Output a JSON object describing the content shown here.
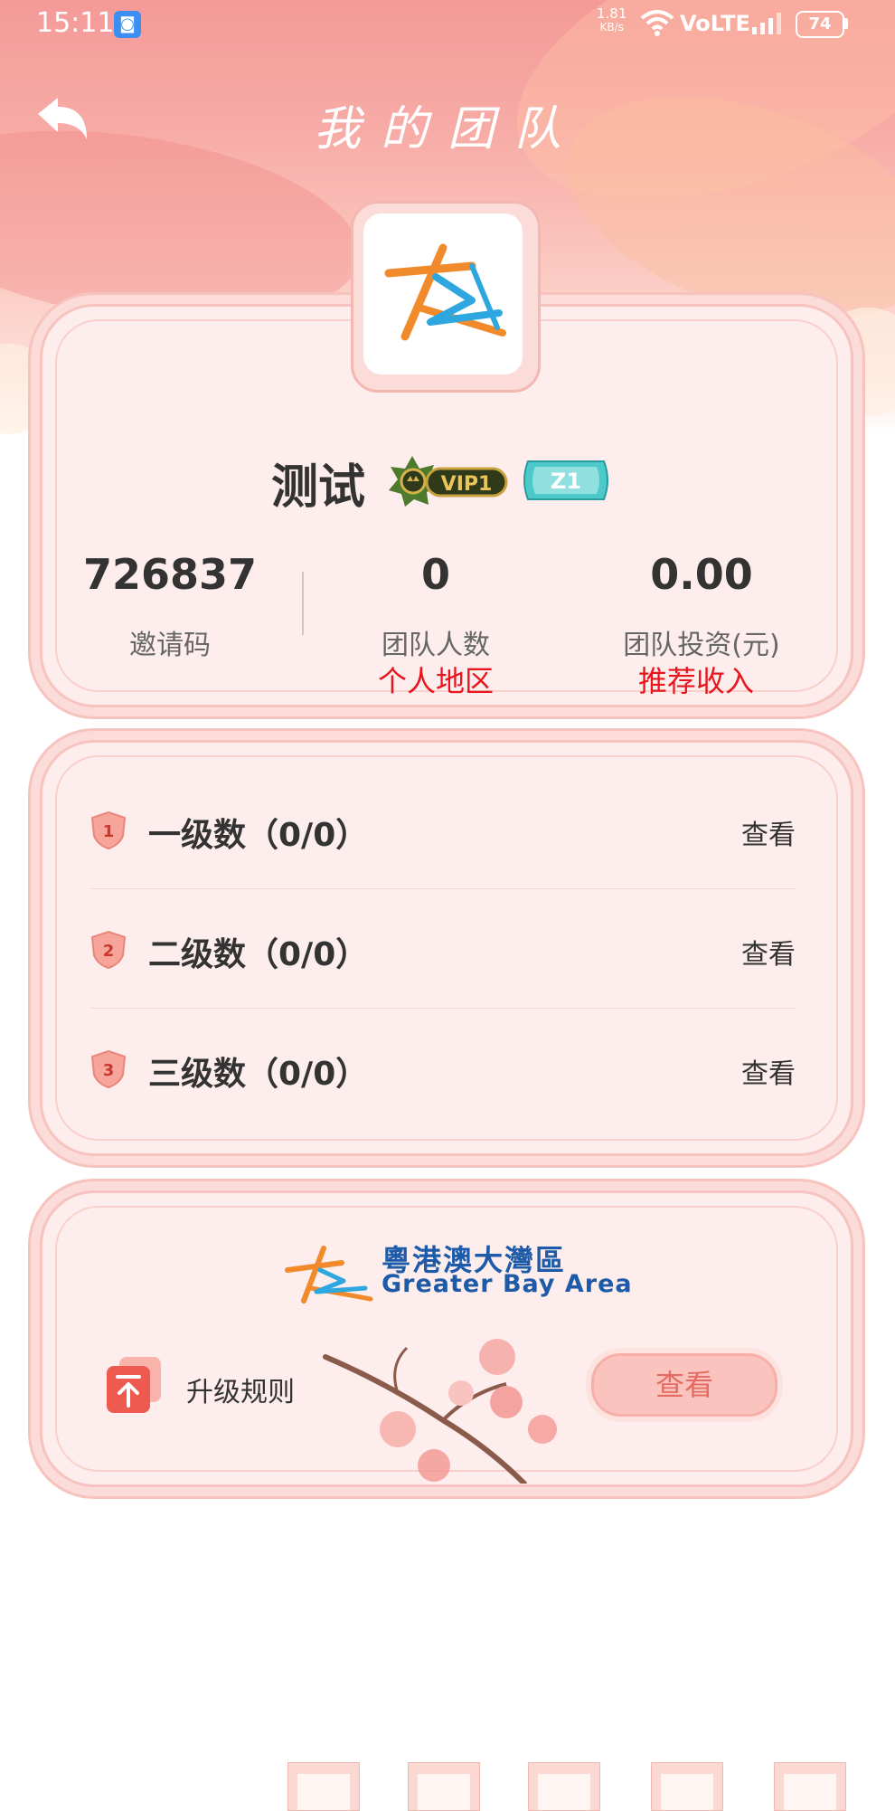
{
  "status_bar": {
    "time": "15:11",
    "net_speed": "1.81",
    "net_unit": "KB/s",
    "network": "VoLTE",
    "battery": "74"
  },
  "header": {
    "title": "我的团队",
    "back_icon": "back-arrow-icon"
  },
  "profile": {
    "username": "测试",
    "vip_badge": "VIP1",
    "zone_badge": "Z1",
    "stats": [
      {
        "value": "726837",
        "label": "邀请码",
        "sub": ""
      },
      {
        "value": "0",
        "label": "团队人数",
        "sub": "个人地区"
      },
      {
        "value": "0.00",
        "label": "团队投资(元)",
        "sub": "推荐收入"
      }
    ]
  },
  "levels": [
    {
      "num": "1",
      "label": "一级数（0/0）",
      "action": "查看"
    },
    {
      "num": "2",
      "label": "二级数（0/0）",
      "action": "查看"
    },
    {
      "num": "3",
      "label": "三级数（0/0）",
      "action": "查看"
    }
  ],
  "promo": {
    "logo_cn": "粵港澳大灣區",
    "logo_en": "Greater Bay Area",
    "upgrade_label": "升级规则",
    "upgrade_action": "查看"
  },
  "colors": {
    "accent_red": "#e8151d",
    "card_bg": "#fdeeed",
    "brand_blue": "#1d5aa8"
  }
}
